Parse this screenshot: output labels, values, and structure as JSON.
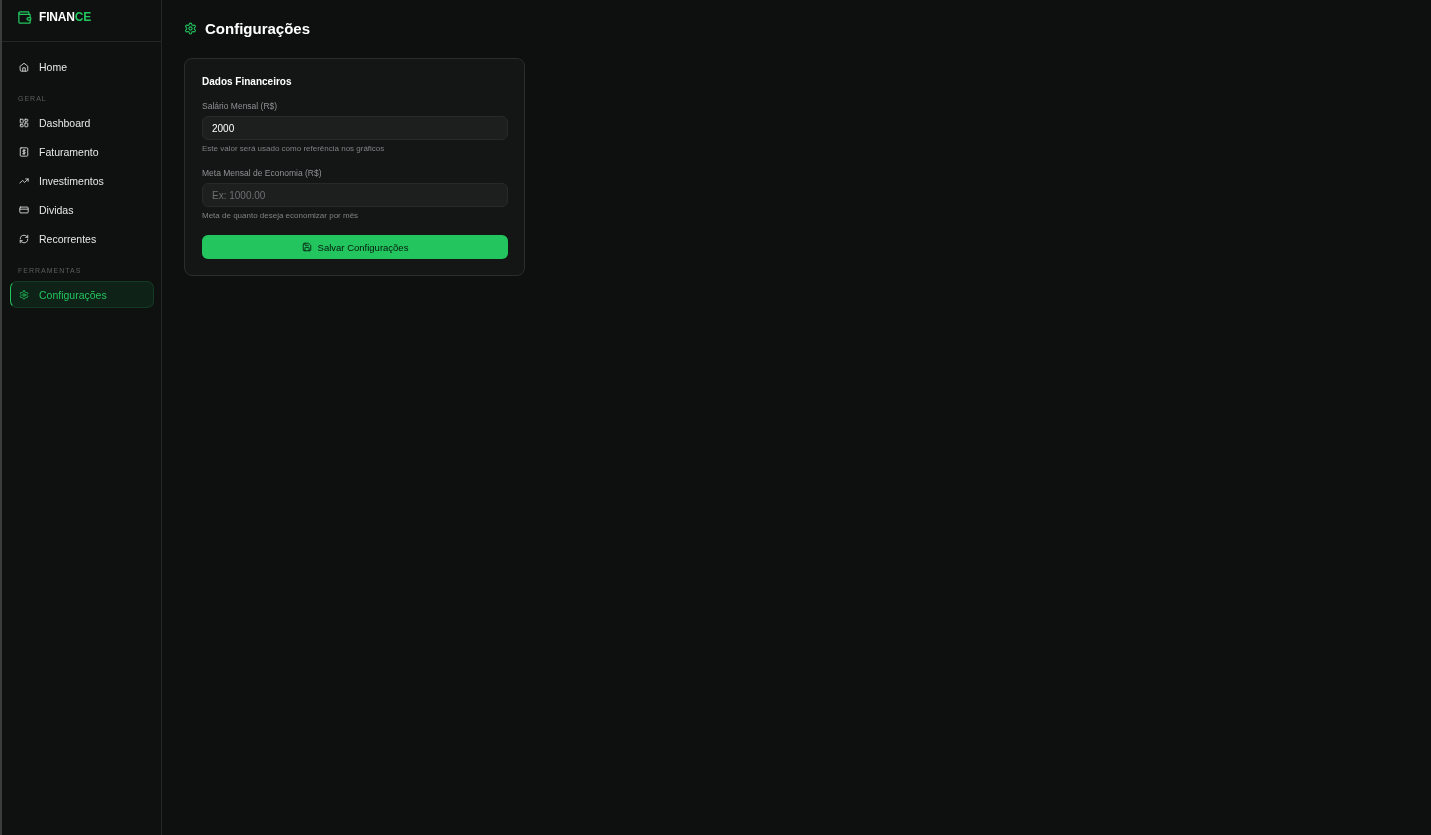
{
  "sidebar": {
    "logo": {
      "primary": "FINAN",
      "accent": "CE"
    },
    "groups": [
      {
        "items": [
          {
            "label": "Home",
            "selected": false
          }
        ]
      },
      {
        "heading": "GERAL",
        "items": [
          {
            "label": "Dashboard",
            "selected": false
          },
          {
            "label": "Faturamento",
            "selected": false
          },
          {
            "label": "Investimentos",
            "selected": false
          },
          {
            "label": "Dividas",
            "selected": false
          },
          {
            "label": "Recorrentes",
            "selected": false
          }
        ]
      },
      {
        "heading": "FERRAMENTAS",
        "items": [
          {
            "label": "Configurações",
            "selected": true
          }
        ]
      }
    ]
  },
  "page": {
    "title": "Configurações"
  },
  "settings_card": {
    "title": "Dados Financeiros",
    "fields": [
      {
        "label": "Salário Mensal (R$)",
        "value": "2000",
        "hint": "Este valor será usado como referência nos gráficos"
      },
      {
        "label": "Meta Mensal de Economia (R$)",
        "placeholder": "Ex: 1000.00",
        "hint": "Meta de quanto deseja economizar por mês"
      }
    ],
    "button": "Salvar Configurações"
  }
}
